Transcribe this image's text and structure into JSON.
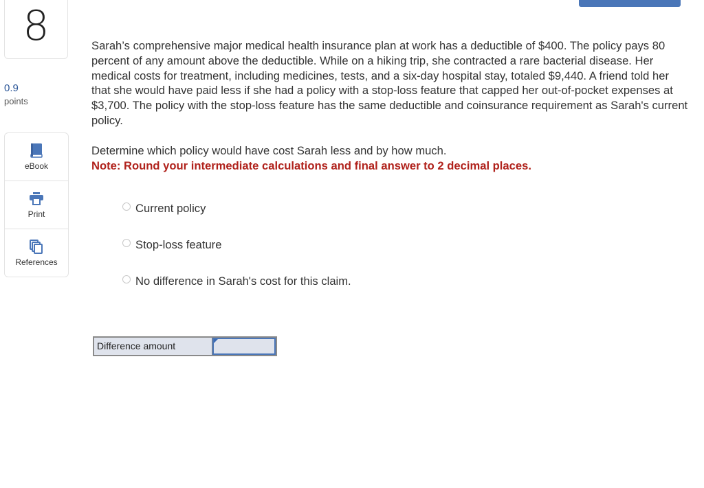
{
  "question": {
    "number": "8",
    "points_value": "0.9",
    "points_label": "points"
  },
  "tools": [
    {
      "label": "eBook",
      "icon": "book-icon"
    },
    {
      "label": "Print",
      "icon": "printer-icon"
    },
    {
      "label": "References",
      "icon": "copy-documents-icon"
    }
  ],
  "problem": {
    "paragraph": "Sarah’s comprehensive major medical health insurance plan at work has a deductible of $400. The policy pays 80 percent of any amount above the deductible. While on a hiking trip, she contracted a rare bacterial disease. Her medical costs for treatment, including medicines, tests, and a six-day hospital stay, totaled $9,440. A friend told her that she would have paid less if she had a policy with a stop-loss feature that capped her out-of-pocket expenses at $3,700. The policy with the stop-loss feature has the same deductible and coinsurance requirement as Sarah's current policy.",
    "instruction": "Determine which policy would have cost Sarah less and by how much.",
    "note": "Note: Round your intermediate calculations and final answer to 2 decimal places."
  },
  "options": [
    {
      "label": "Current policy",
      "selected": false
    },
    {
      "label": "Stop-loss feature",
      "selected": false
    },
    {
      "label": "No difference in Sarah's cost for this claim.",
      "selected": false
    }
  ],
  "answer": {
    "label": "Difference amount",
    "value": ""
  },
  "colors": {
    "accent": "#4a76b8",
    "note_red": "#b0221c",
    "points_blue": "#2a5597"
  }
}
